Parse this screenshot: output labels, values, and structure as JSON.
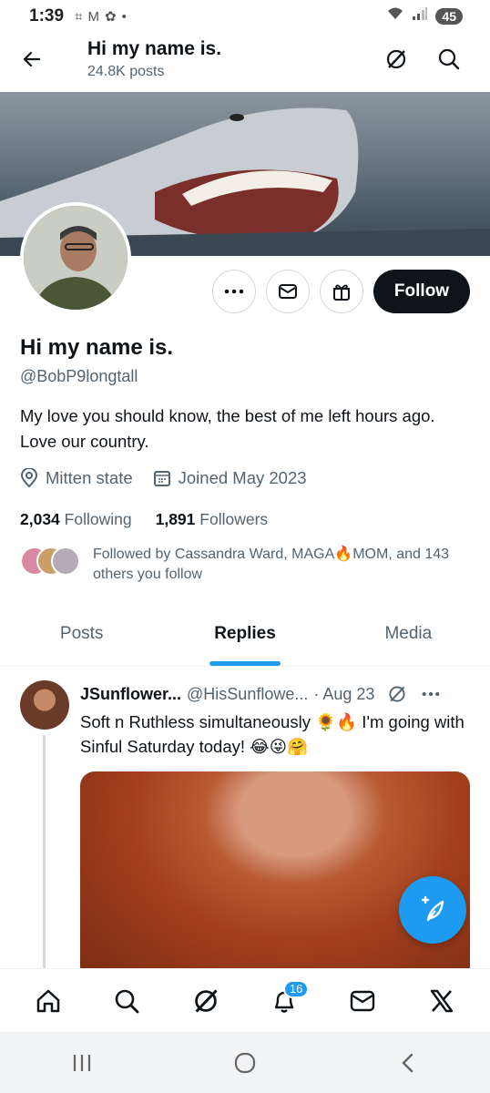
{
  "status_bar": {
    "time": "1:39",
    "battery": "45"
  },
  "header": {
    "title": "Hi my name is.",
    "subtitle": "24.8K posts"
  },
  "profile": {
    "display_name": "Hi my name is.",
    "handle": "@BobP9longtall",
    "bio": "My love you should know, the best of me left hours ago. Love our country.",
    "location": "Mitten state",
    "joined": "Joined May 2023",
    "following_count": "2,034",
    "following_label": "Following",
    "followers_count": "1,891",
    "followers_label": "Followers",
    "followed_by": "Followed by Cassandra Ward, MAGA🔥MOM, and 143 others you follow",
    "follow_label": "Follow"
  },
  "tabs": [
    {
      "label": "Posts"
    },
    {
      "label": "Replies"
    },
    {
      "label": "Media"
    }
  ],
  "tweet": {
    "name": "JSunflower...",
    "handle": "@HisSunflowe...",
    "date": "· Aug 23",
    "text": "Soft n Ruthless simultaneously 🌻🔥 I'm going with Sinful Saturday today! 😂😜🤗"
  },
  "bottom_nav": {
    "notifications_badge": "16"
  },
  "colors": {
    "accent": "#1d9bf0",
    "text": "#0f1419",
    "muted": "#536471",
    "follow_bg": "#0f1419"
  }
}
